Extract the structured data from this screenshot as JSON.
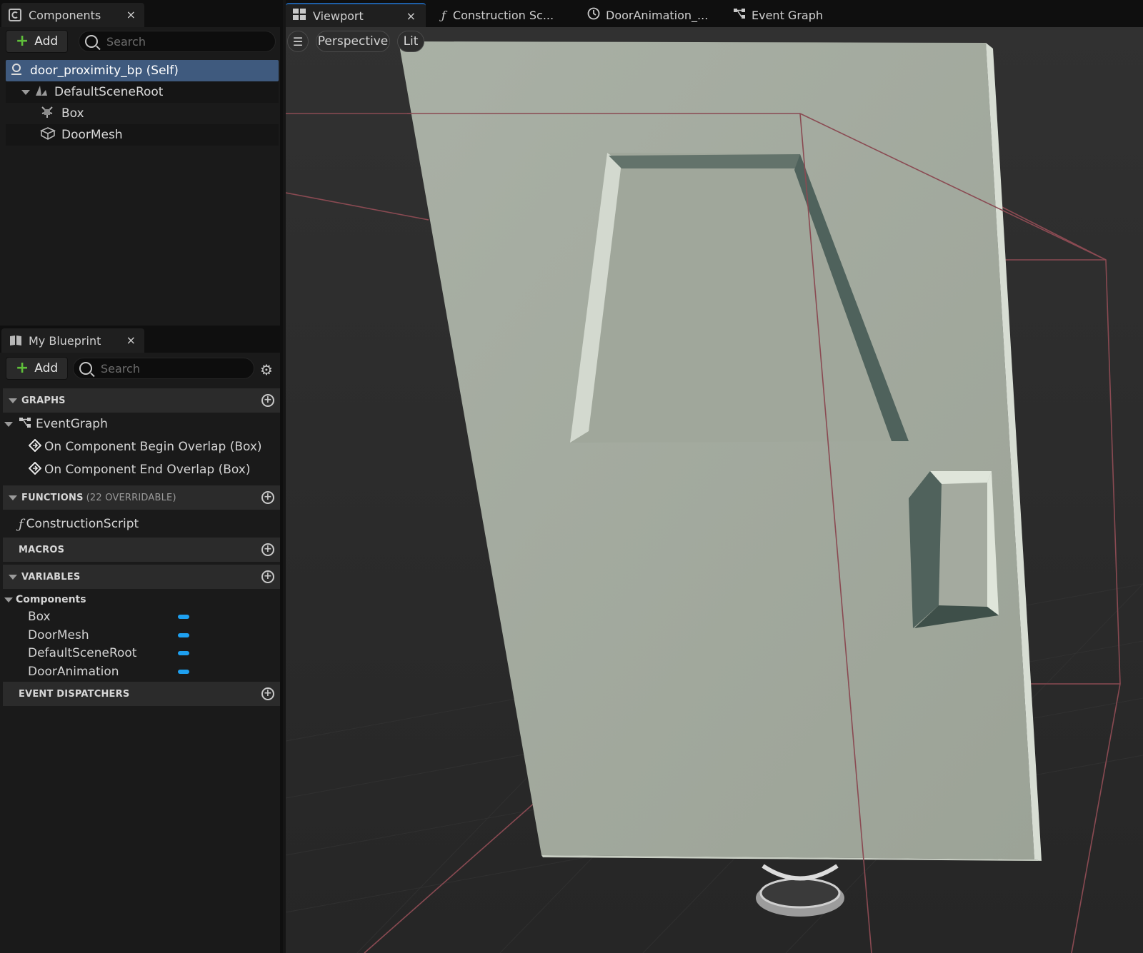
{
  "components_panel": {
    "tab_label": "Components",
    "close": "×",
    "add_label": "Add",
    "search_placeholder": "Search",
    "tree": [
      {
        "label": "door_proximity_bp (Self)",
        "icon": "blueprint-self-icon"
      },
      {
        "label": "DefaultSceneRoot",
        "icon": "scene-root-icon"
      },
      {
        "label": "Box",
        "icon": "box-collision-icon"
      },
      {
        "label": "DoorMesh",
        "icon": "static-mesh-icon"
      }
    ]
  },
  "my_blueprint": {
    "tab_label": "My Blueprint",
    "close": "×",
    "add_label": "Add",
    "search_placeholder": "Search",
    "sections": {
      "graphs": "GRAPHS",
      "functions": "FUNCTIONS",
      "functions_sub": "(22 OVERRIDABLE)",
      "macros": "MACROS",
      "variables": "VARIABLES",
      "event_dispatchers": "EVENT DISPATCHERS"
    },
    "graphs": {
      "event_graph": "EventGraph",
      "events": [
        "On Component Begin Overlap (Box)",
        "On Component End Overlap (Box)"
      ]
    },
    "functions": [
      "ConstructionScript"
    ],
    "variables_category": "Components",
    "variables": [
      "Box",
      "DoorMesh",
      "DefaultSceneRoot",
      "DoorAnimation"
    ],
    "variable_color": "#1ea0f0"
  },
  "editor_tabs": [
    {
      "label": "Viewport",
      "close": "×"
    },
    {
      "label": "Construction Sc..."
    },
    {
      "label": "DoorAnimation_..."
    },
    {
      "label": "Event Graph"
    }
  ],
  "viewport_toolbar": {
    "view_mode": "Perspective",
    "lighting": "Lit"
  },
  "colors": {
    "selection": "#3f5a7e",
    "door": "#a3a99d",
    "bounds_line": "#8a4a52"
  }
}
